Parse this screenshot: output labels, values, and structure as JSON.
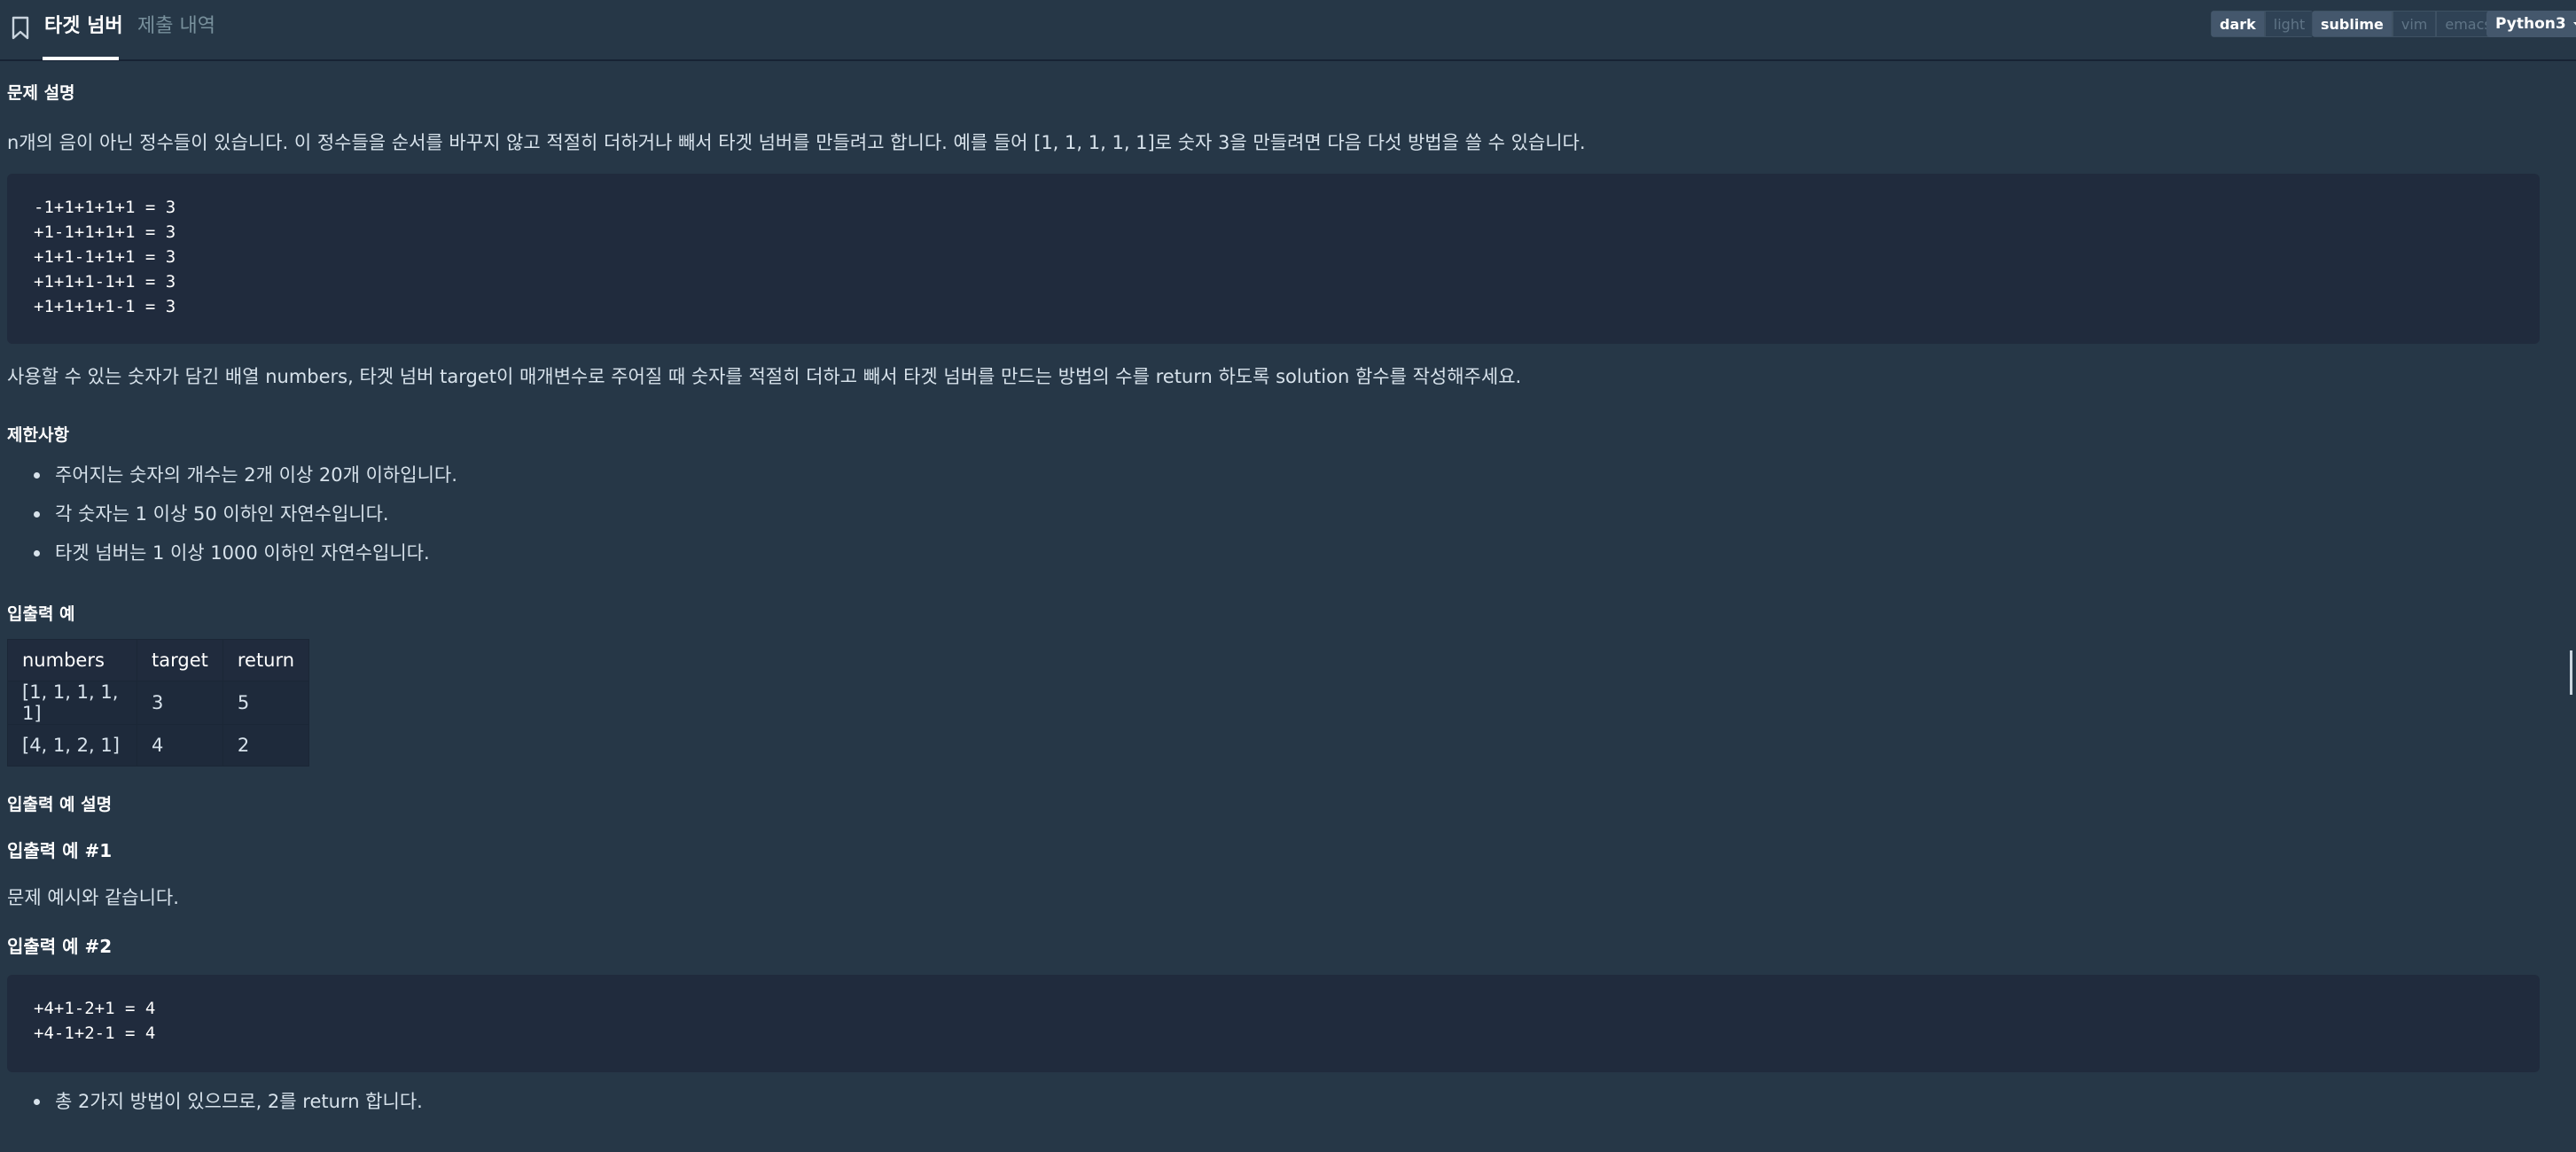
{
  "header": {
    "tabs": [
      {
        "label": "타겟 넘버",
        "active": true
      },
      {
        "label": "제출 내역",
        "active": false
      }
    ],
    "theme_toggle": [
      "dark",
      "light"
    ],
    "keymap_toggle": [
      "sublime",
      "vim",
      "emacs"
    ],
    "language": "Python3"
  },
  "problem": {
    "description_heading": "문제 설명",
    "description": "n개의 음이 아닌 정수들이 있습니다. 이 정수들을 순서를 바꾸지 않고 적절히 더하거나 빼서 타겟 넘버를 만들려고 합니다. 예를 들어 [1, 1, 1, 1, 1]로 숫자 3을 만들려면 다음 다섯 방법을 쓸 수 있습니다.",
    "example_code": [
      "-1+1+1+1+1 = 3",
      "+1-1+1+1+1 = 3",
      "+1+1-1+1+1 = 3",
      "+1+1+1-1+1 = 3",
      "+1+1+1+1-1 = 3"
    ],
    "task": "사용할 수 있는 숫자가 담긴 배열 numbers, 타겟 넘버 target이 매개변수로 주어질 때 숫자를 적절히 더하고 빼서 타겟 넘버를 만드는 방법의 수를 return 하도록 solution 함수를 작성해주세요.",
    "constraints_heading": "제한사항",
    "constraints": [
      "주어지는 숫자의 개수는 2개 이상 20개 이하입니다.",
      "각 숫자는 1 이상 50 이하인 자연수입니다.",
      "타겟 넘버는 1 이상 1000 이하인 자연수입니다."
    ],
    "io_heading": "입출력 예",
    "io_table": {
      "headers": [
        "numbers",
        "target",
        "return"
      ],
      "rows": [
        [
          "[1, 1, 1, 1, 1]",
          "3",
          "5"
        ],
        [
          "[4, 1, 2, 1]",
          "4",
          "2"
        ]
      ]
    },
    "io_explain_heading": "입출력 예 설명",
    "io_ex1_heading": "입출력 예 #1",
    "io_ex1_text": "문제 예시와 같습니다.",
    "io_ex2_heading": "입출력 예 #2",
    "io_ex2_code": [
      "+4+1-2+1 = 4",
      "+4-1+2-1 = 4"
    ],
    "io_ex2_bullets": [
      "총 2가지 방법이 있으므로, 2를 return 합니다."
    ]
  },
  "colors": {
    "background": "#263747",
    "code_background": "#202b3d",
    "text": "#d7e2eb",
    "heading": "#ffffff"
  }
}
